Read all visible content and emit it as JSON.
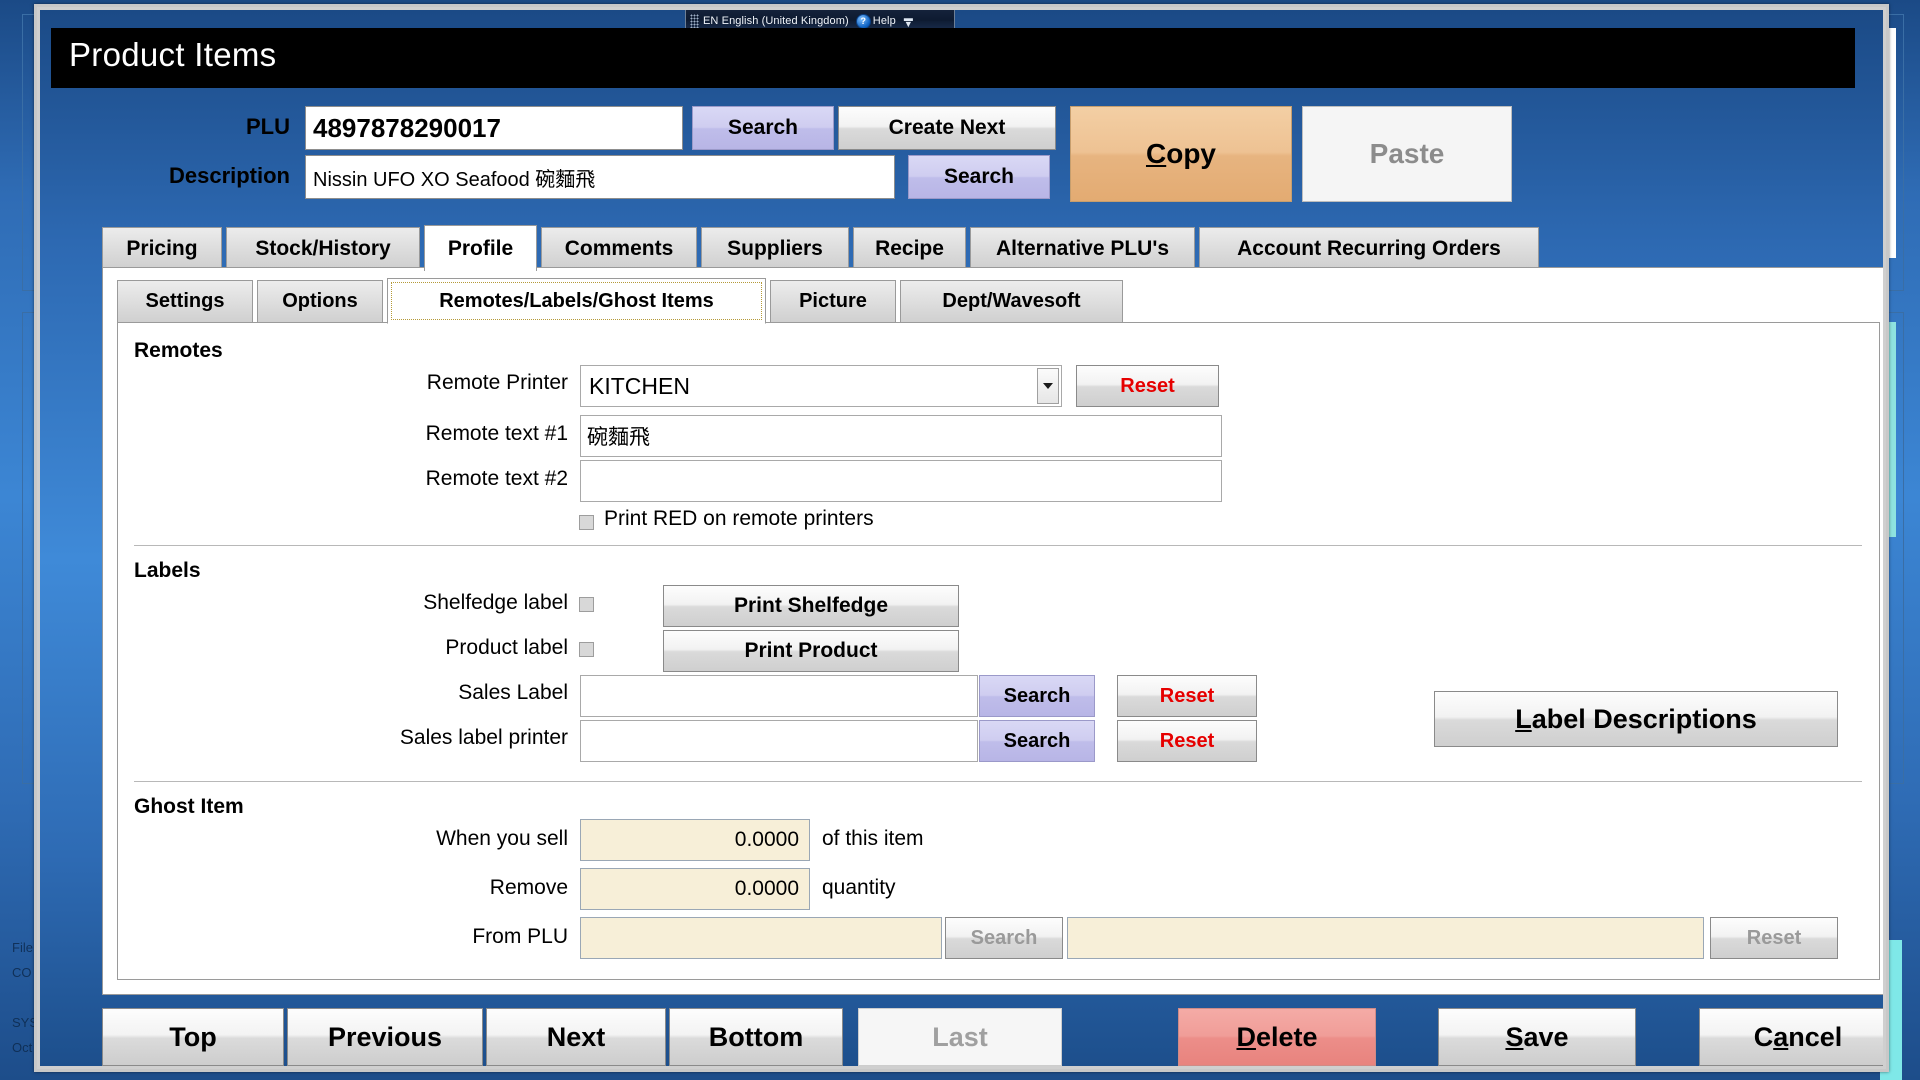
{
  "background": {
    "texts": [
      "File",
      "CO",
      "SYS",
      "Oct"
    ]
  },
  "language_bar": {
    "indicator": "EN",
    "language": "English (United Kingdom)",
    "help_label": "Help",
    "help_icon": "question-mark-icon",
    "grip_icon": "drag-grip-icon",
    "arrows_icon": "minimize-restore-icon"
  },
  "window": {
    "title": "Product Items"
  },
  "header": {
    "plu_label": "PLU",
    "plu_value": "4897878290017",
    "plu_search_label": "Search",
    "create_next_label": "Create Next",
    "description_label": "Description",
    "description_value": "Nissin UFO XO Seafood 碗麵飛",
    "description_search_label": "Search",
    "copy_label_pre": "C",
    "copy_label_post": "opy",
    "paste_label": "Paste"
  },
  "tabs": [
    {
      "label": "Pricing",
      "active": false
    },
    {
      "label": "Stock/History",
      "active": false
    },
    {
      "label": "Profile",
      "active": true
    },
    {
      "label": "Comments",
      "active": false
    },
    {
      "label": "Suppliers",
      "active": false
    },
    {
      "label": "Recipe",
      "active": false
    },
    {
      "label": "Alternative PLU's",
      "active": false
    },
    {
      "label": "Account Recurring Orders",
      "active": false
    }
  ],
  "subtabs": [
    {
      "label": "Settings",
      "active": false
    },
    {
      "label": "Options",
      "active": false
    },
    {
      "label": "Remotes/Labels/Ghost Items",
      "active": true
    },
    {
      "label": "Picture",
      "active": false
    },
    {
      "label": "Dept/Wavesoft",
      "active": false
    }
  ],
  "remotes": {
    "section_title": "Remotes",
    "printer_label": "Remote Printer",
    "printer_value": "KITCHEN",
    "printer_reset_label": "Reset",
    "text1_label": "Remote text #1",
    "text1_value": "碗麵飛",
    "text2_label": "Remote text #2",
    "text2_value": "",
    "print_red_label": "Print RED on remote printers"
  },
  "labels": {
    "section_title": "Labels",
    "shelfedge_label": "Shelfedge label",
    "print_shelfedge_label": "Print Shelfedge",
    "product_label": "Product label",
    "print_product_label": "Print Product",
    "sales_label_label": "Sales Label",
    "sales_label_value": "",
    "sales_label_search": "Search",
    "sales_label_reset": "Reset",
    "sales_printer_label": "Sales label printer",
    "sales_printer_value": "",
    "sales_printer_search": "Search",
    "sales_printer_reset": "Reset",
    "label_descriptions_pre": "L",
    "label_descriptions_post": "abel Descriptions"
  },
  "ghost_item": {
    "section_title": "Ghost Item",
    "when_you_sell_label": "When you sell",
    "when_you_sell_value": "0.0000",
    "of_this_item_label": "of this item",
    "remove_label": "Remove",
    "remove_value": "0.0000",
    "quantity_label": "quantity",
    "from_plu_label": "From PLU",
    "from_plu_value": "",
    "from_plu_search": "Search",
    "from_plu_desc_value": "",
    "from_plu_reset": "Reset"
  },
  "footer": {
    "top_label": "Top",
    "previous_label": "Previous",
    "next_label": "Next",
    "bottom_label": "Bottom",
    "last_label": "Last",
    "delete_pre": "D",
    "delete_post": "elete",
    "save_pre": "S",
    "save_post": "ave",
    "cancel_pre": "C",
    "cancel_mid": "a",
    "cancel_post": "ncel"
  }
}
